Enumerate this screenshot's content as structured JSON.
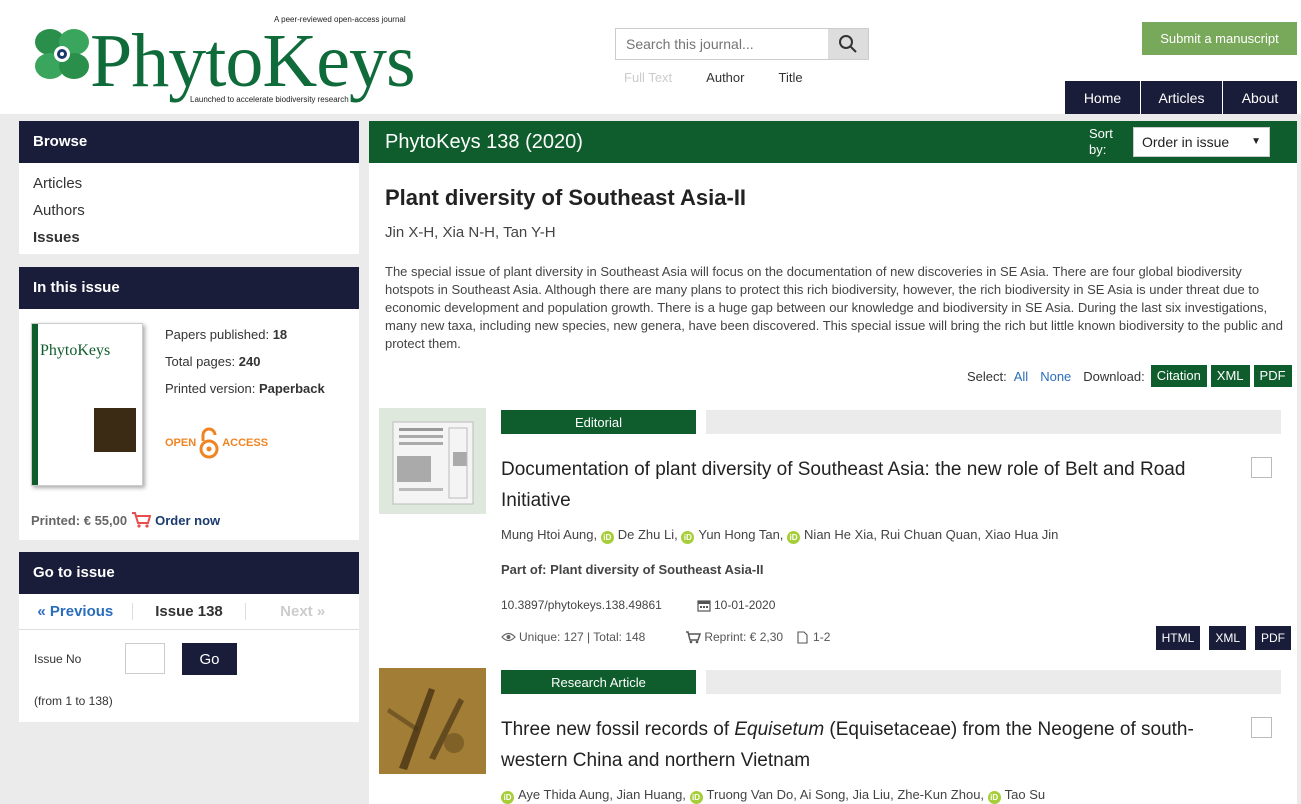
{
  "header": {
    "logo_tagline": "A peer-reviewed open-access journal",
    "logo_text": "PhytoKeys",
    "logo_subtitle": "Launched to accelerate biodiversity research",
    "search_placeholder": "Search this journal...",
    "search_options": [
      "Full Text",
      "Author",
      "Title"
    ],
    "submit_label": "Submit a manuscript",
    "nav": [
      "Home",
      "Articles",
      "About"
    ]
  },
  "browse": {
    "title": "Browse",
    "items": [
      "Articles",
      "Authors",
      "Issues"
    ]
  },
  "in_issue": {
    "title": "In this issue",
    "cover_title": "PhytoKeys",
    "papers_label": "Papers published:",
    "papers_value": "18",
    "pages_label": "Total pages:",
    "pages_value": "240",
    "printed_label": "Printed version:",
    "printed_value": "Paperback",
    "oa_open": "OPEN",
    "oa_access": "ACCESS",
    "price": "Printed: € 55,00",
    "order": "Order now"
  },
  "goto": {
    "title": "Go to issue",
    "prev": "« Previous",
    "current": "Issue 138",
    "next": "Next »",
    "issue_no_label": "Issue No",
    "go_label": "Go",
    "range": "(from 1 to 138)"
  },
  "main": {
    "volume": "PhytoKeys 138 (2020)",
    "sort_label": "Sort by:",
    "sort_value": "Order in issue",
    "issue_title": "Plant diversity of Southeast Asia-II",
    "editors": "Jin X-H, Xia N-H, Tan Y-H",
    "description": "The special issue of plant diversity in Southeast Asia will focus on the documentation of new discoveries in SE Asia. There are four global biodiversity hotspots in Southeast Asia. Although there are many plans to protect this rich biodiversity, however, the rich biodiversity in SE Asia is under threat due to economic development and population growth. There is a huge gap between our knowledge and biodiversity in SE Asia. During the last six investigations, many new taxa, including new species, new genera, have been discovered. This special issue will bring the rich but little known biodiversity to the public and protect them.",
    "select_label": "Select:",
    "select_all": "All",
    "select_none": "None",
    "download_label": "Download:",
    "download_buttons": [
      "Citation",
      "XML",
      "PDF"
    ]
  },
  "articles": [
    {
      "type": "Editorial",
      "title": "Documentation of plant diversity of Southeast Asia: the new role of Belt and Road Initiative",
      "authors": [
        {
          "name": "Mung Htoi Aung,",
          "orcid": false
        },
        {
          "name": "De Zhu Li,",
          "orcid": true
        },
        {
          "name": "Yun Hong Tan,",
          "orcid": true
        },
        {
          "name": "Nian He Xia, Rui Chuan Quan, Xiao Hua Jin",
          "orcid": true
        }
      ],
      "part_of": "Part of: Plant diversity of Southeast Asia-II",
      "doi": "10.3897/phytokeys.138.49861",
      "date": "10-01-2020",
      "stats": "Unique: 127 | Total: 148",
      "reprint": "Reprint: € 2,30",
      "pages": "1-2",
      "formats": [
        "HTML",
        "XML",
        "PDF"
      ]
    },
    {
      "type": "Research Article",
      "title_pre": "Three new fossil records of ",
      "title_italic": "Equisetum",
      "title_post": " (Equisetaceae) from the Neogene of south-western China and northern Vietnam",
      "authors": [
        {
          "name": "Aye Thida Aung, Jian Huang,",
          "orcid": true
        },
        {
          "name": "Truong Van Do, Ai Song, Jia Liu, Zhe-Kun Zhou,",
          "orcid": true
        },
        {
          "name": "Tao Su",
          "orcid": true
        }
      ]
    }
  ],
  "colors": {
    "brand_green": "#0f5d2c",
    "navy": "#1a1d3a",
    "submit_green": "#78a859",
    "link_blue": "#2a6ebb",
    "orcid_green": "#a6ce39"
  }
}
